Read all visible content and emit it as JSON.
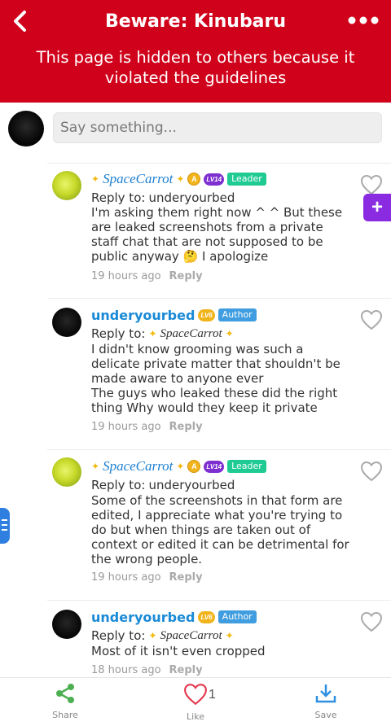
{
  "header": {
    "back_glyph": "<",
    "title": "Beware: Kinubaru",
    "more_glyph": "•••",
    "notice": "This page is hidden to others because it violated the guidelines"
  },
  "composer": {
    "placeholder": "Say something..."
  },
  "fab_glyph": "+",
  "comments": [
    {
      "author": "SpaceCarrot",
      "level": "LV14",
      "role": "Leader",
      "reply_to_label": "Reply to:",
      "reply_to": "underyourbed",
      "text": "I'm asking them right now ^ ^ But these are leaked screenshots from a private staff chat that are not supposed to be public anyway 🤔 I apologize",
      "time": "19 hours ago",
      "reply_label": "Reply"
    },
    {
      "author": "underyourbed",
      "level": "LV6",
      "role": "Author",
      "reply_to_label": "Reply to:",
      "reply_to": "SpaceCarrot",
      "text": "I didn't know grooming was such a delicate private matter that shouldn't be made aware to anyone ever\nThe guys who leaked these did the right thing Why would they keep it private",
      "time": "19 hours ago",
      "reply_label": "Reply"
    },
    {
      "author": "SpaceCarrot",
      "level": "LV14",
      "role": "Leader",
      "reply_to_label": "Reply to:",
      "reply_to": "underyourbed",
      "text": "Some of the screenshots in that form are edited, I appreciate what you're trying to do but when things are taken out of context or edited it can be detrimental for the wrong people.",
      "time": "19 hours ago",
      "reply_label": "Reply"
    },
    {
      "author": "underyourbed",
      "level": "LV6",
      "role": "Author",
      "reply_to_label": "Reply to:",
      "reply_to": "SpaceCarrot",
      "text": "Most of it isn't even cropped",
      "time": "18 hours ago",
      "reply_label": "Reply"
    }
  ],
  "bottom_bar": {
    "share_label": "Share",
    "like_label": "Like",
    "like_count": "1",
    "save_label": "Save"
  },
  "colors": {
    "header_bg": "#d0021b",
    "accent_purple": "#8a2be2",
    "share_green": "#4caf50",
    "like_red": "#e53950",
    "save_blue": "#2f8fe0"
  }
}
